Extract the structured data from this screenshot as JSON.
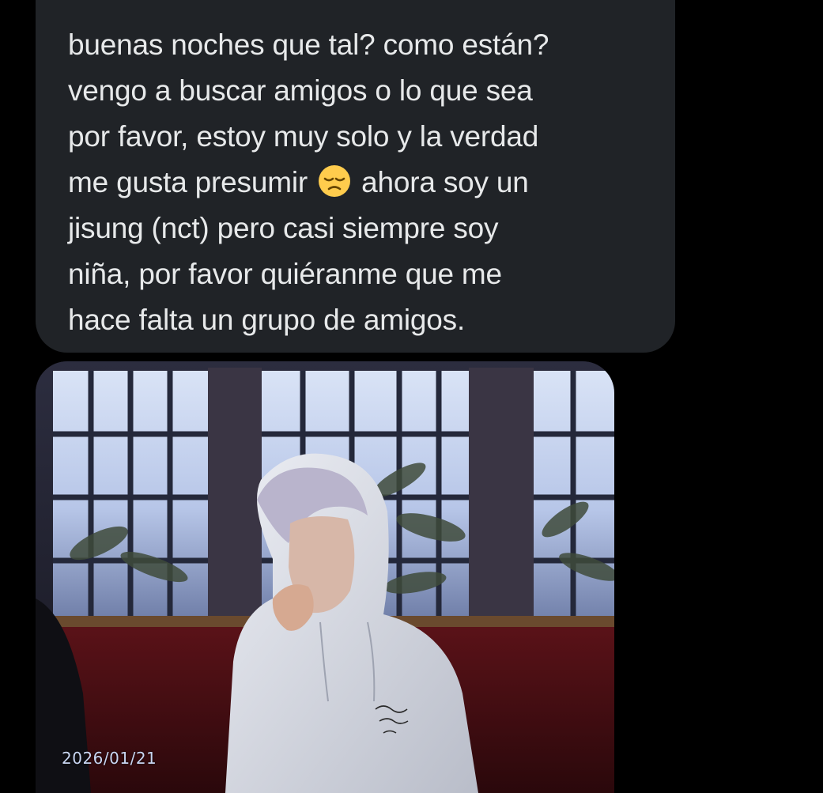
{
  "message": {
    "text_before_emoji": "buenas noches que tal? como están?\nvengo a buscar amigos o lo que sea\npor favor, estoy muy solo y la verdad\nme gusta presumir ",
    "emoji": "disappointed-face-emoji",
    "text_after_emoji": " ahora soy un\njisung (nct) pero casi siempre soy\nniña, por favor quiéranme que me\nhace falta un grupo de amigos."
  },
  "photo": {
    "date_stamp": "2026/01/21"
  },
  "colors": {
    "background": "#000000",
    "bubble": "#202327",
    "text": "#e7e9ea",
    "date_stamp": "#c9d6f2"
  }
}
